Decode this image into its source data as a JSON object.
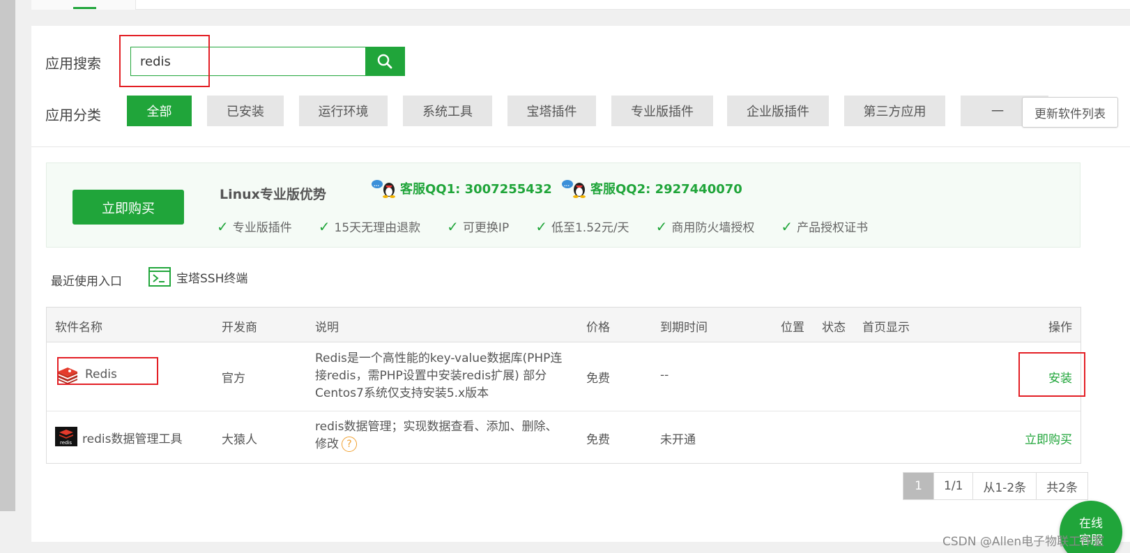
{
  "search": {
    "label": "应用搜索",
    "value": "redis"
  },
  "categories": {
    "label": "应用分类",
    "items": [
      "全部",
      "已安装",
      "运行环境",
      "系统工具",
      "宝塔插件",
      "专业版插件",
      "企业版插件",
      "第三方应用",
      "一"
    ],
    "refresh": "更新软件列表"
  },
  "promo": {
    "buy": "立即购买",
    "title": "Linux专业版优势",
    "qq1": "客服QQ1: 3007255432",
    "qq2": "客服QQ2: 2927440070",
    "perks": [
      "专业版插件",
      "15天无理由退款",
      "可更换IP",
      "低至1.52元/天",
      "商用防火墙授权",
      "产品授权证书"
    ]
  },
  "recent": {
    "label": "最近使用入口",
    "ssh": "宝塔SSH终端"
  },
  "table": {
    "headers": [
      "软件名称",
      "开发商",
      "说明",
      "价格",
      "到期时间",
      "位置",
      "状态",
      "首页显示",
      "操作"
    ],
    "rows": [
      {
        "name": "Redis",
        "vendor": "官方",
        "desc": [
          "Redis是一个高性能的key-value数据库(PHP连",
          "接redis，需PHP设置中安装redis扩展) 部分",
          "Centos7系统仅支持安装5.x版本"
        ],
        "price": "免费",
        "expire": "--",
        "action": "安装"
      },
      {
        "name": "redis数据管理工具",
        "vendor": "大猿人",
        "desc": [
          "redis数据管理；实现数据查看、添加、删除、",
          "修改"
        ],
        "price": "免费",
        "expire": "未开通",
        "action": "立即购买"
      }
    ]
  },
  "pager": {
    "current": "1",
    "pages": "1/1",
    "range": "从1-2条",
    "total": "共2条"
  },
  "chat": {
    "line1": "在线",
    "line2": "客服"
  },
  "watermark": "CSDN @Allen电子物联工作室",
  "colors": {
    "accent": "#20a53a",
    "highlight": "#e31e24"
  }
}
